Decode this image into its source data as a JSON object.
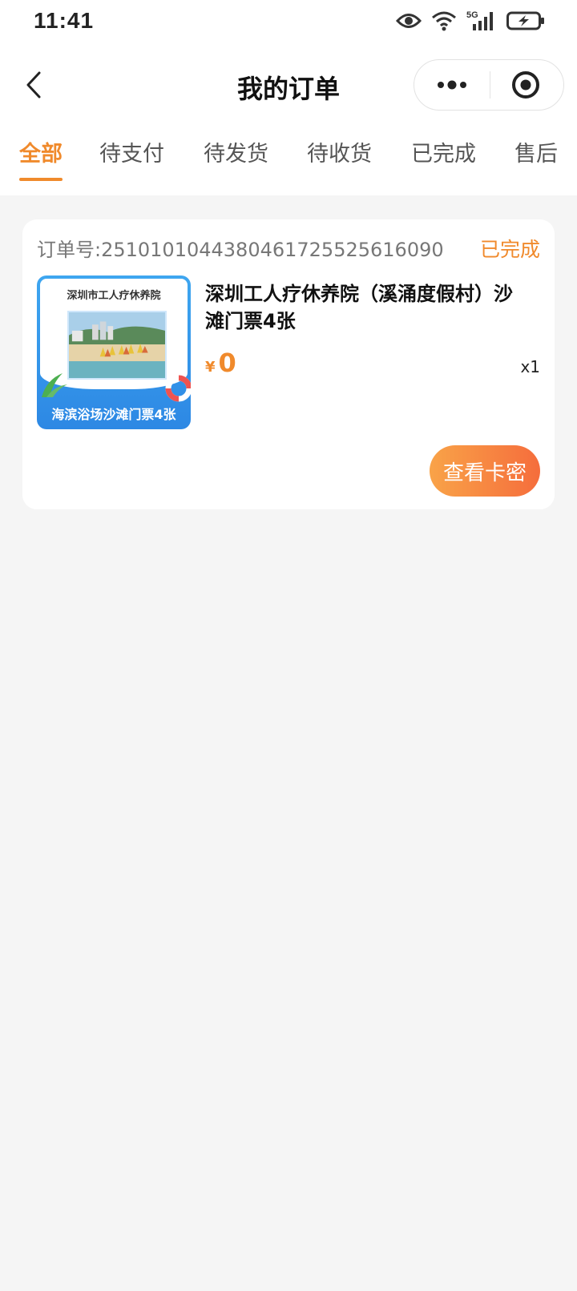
{
  "status_bar": {
    "time": "11:41",
    "network": "5G",
    "icons": [
      "eye-icon",
      "wifi-icon",
      "signal-icon",
      "battery-charging-icon"
    ]
  },
  "nav": {
    "title": "我的订单",
    "back_icon": "chevron-left-icon",
    "more_icon": "more-dots-icon",
    "close_icon": "target-close-icon"
  },
  "tabs": [
    {
      "label": "全部",
      "active": true
    },
    {
      "label": "待支付",
      "active": false
    },
    {
      "label": "待发货",
      "active": false
    },
    {
      "label": "待收货",
      "active": false
    },
    {
      "label": "已完成",
      "active": false
    },
    {
      "label": "售后",
      "active": false
    }
  ],
  "order": {
    "order_no": "订单号:2510101044380461725525616090",
    "status": "已完成",
    "product": {
      "title": "深圳工人疗休养院（溪涌度假村）沙滩门票4张",
      "thumb_caption": "深圳市工人疗休养院",
      "thumb_banner": "海滨浴场沙滩门票4张"
    },
    "price_symbol": "¥",
    "price": "0",
    "quantity": "x1",
    "action_label": "查看卡密"
  },
  "colors": {
    "accent": "#f08a2c",
    "button_gradient_start": "#f9a348",
    "button_gradient_end": "#f56d3c",
    "background": "#f5f5f5"
  }
}
